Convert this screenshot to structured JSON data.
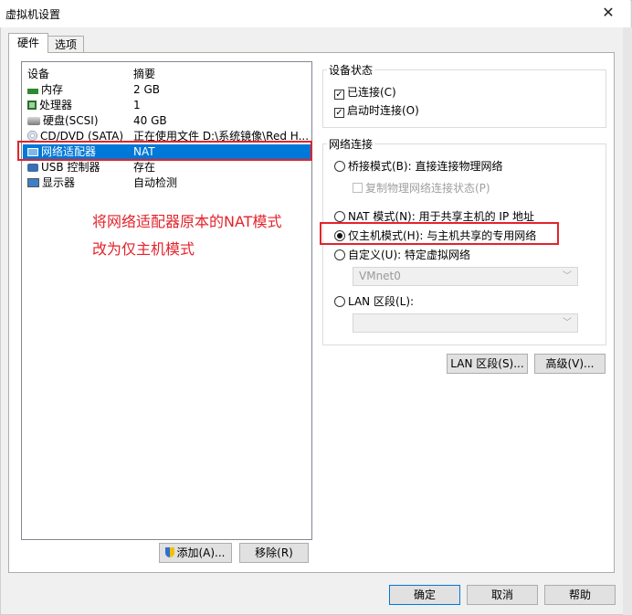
{
  "window": {
    "title": "虚拟机设置",
    "close_glyph": "✕"
  },
  "tabs": [
    {
      "label": "硬件"
    },
    {
      "label": "选项"
    }
  ],
  "device_list": {
    "columns": [
      "设备",
      "摘要"
    ],
    "rows": [
      {
        "name": "内存",
        "summary": "2 GB",
        "icon": "memory-icon"
      },
      {
        "name": "处理器",
        "summary": "1",
        "icon": "cpu-icon"
      },
      {
        "name": "硬盘(SCSI)",
        "summary": "40 GB",
        "icon": "harddisk-icon"
      },
      {
        "name": "CD/DVD (SATA)",
        "summary": "正在使用文件 D:\\系统镜像\\Red H...",
        "icon": "cdrom-icon"
      },
      {
        "name": "网络适配器",
        "summary": "NAT",
        "icon": "network-adapter-icon",
        "selected": true
      },
      {
        "name": "USB 控制器",
        "summary": "存在",
        "icon": "usb-icon"
      },
      {
        "name": "显示器",
        "summary": "自动检测",
        "icon": "monitor-icon"
      }
    ]
  },
  "annotation": {
    "line1": "将网络适配器原本的NAT模式",
    "line2": "改为仅主机模式"
  },
  "buttons": {
    "add": "添加(A)...",
    "remove": "移除(R)",
    "ok": "确定",
    "cancel": "取消",
    "help": "帮助",
    "lan_segments": "LAN 区段(S)...",
    "advanced": "高级(V)..."
  },
  "device_status": {
    "label": "设备状态",
    "connected": {
      "label": "已连接(C)",
      "checked": true
    },
    "connect_at_power_on": {
      "label": "启动时连接(O)",
      "checked": true
    }
  },
  "network_connection": {
    "label": "网络连接",
    "bridged": "桥接模式(B): 直接连接物理网络",
    "replicate": "复制物理网络连接状态(P)",
    "nat": "NAT 模式(N): 用于共享主机的 IP 地址",
    "host_only": "仅主机模式(H): 与主机共享的专用网络",
    "custom": "自定义(U): 特定虚拟网络",
    "custom_select_value": "VMnet0",
    "lan": "LAN 区段(L):",
    "lan_select_value": "",
    "selected": "host_only"
  },
  "colors": {
    "selection": "#0078d7",
    "annotation_red": "#e3232b"
  }
}
